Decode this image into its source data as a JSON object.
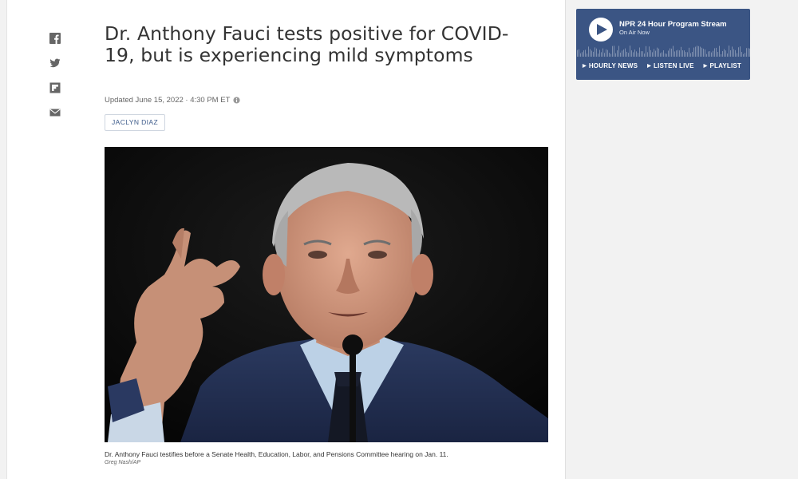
{
  "share": {
    "items": [
      {
        "name": "facebook-icon"
      },
      {
        "name": "twitter-icon"
      },
      {
        "name": "flipboard-icon"
      },
      {
        "name": "email-icon"
      }
    ]
  },
  "article": {
    "headline": "Dr. Anthony Fauci tests positive for COVID-19, but is experiencing mild symptoms",
    "dateline": "Updated June 15, 2022 · 4:30 PM ET",
    "byline": "JACLYN DIAZ",
    "photo": {
      "caption": "Dr. Anthony Fauci testifies before a Senate Health, Education, Labor, and Pensions Committee hearing on Jan. 11.",
      "credit": "Greg Nash/AP"
    }
  },
  "player": {
    "title": "NPR 24 Hour Program Stream",
    "status": "On Air Now",
    "links": [
      "HOURLY NEWS",
      "LISTEN LIVE",
      "PLAYLIST"
    ]
  },
  "colors": {
    "accent": "#3b5584",
    "byline": "#3c5a8a",
    "icon": "#666666"
  }
}
